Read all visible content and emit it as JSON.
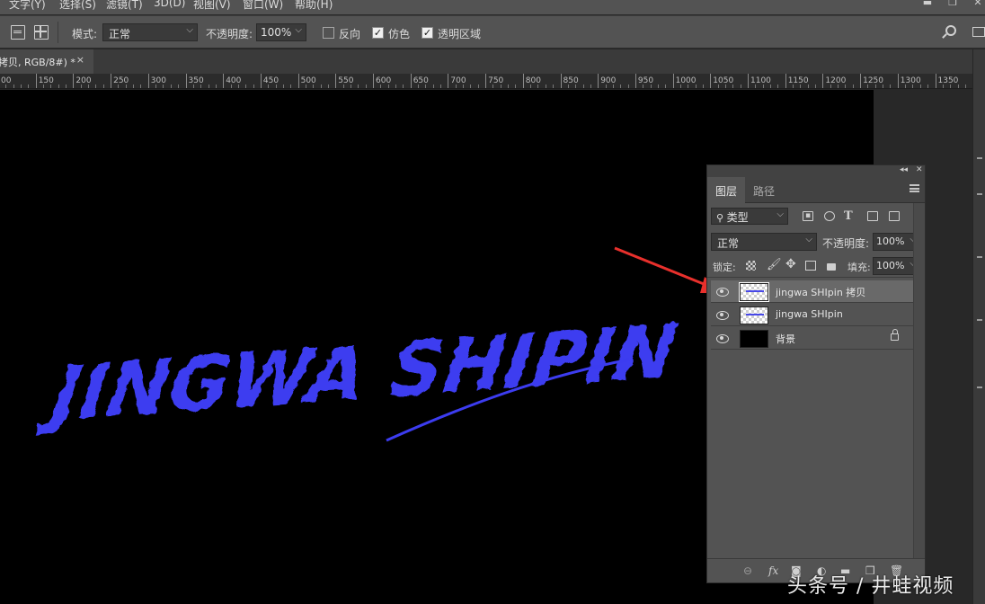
{
  "menubar": {
    "items": [
      "文字(Y)",
      "选择(S)",
      "滤镜(T)",
      "3D(D)",
      "视图(V)",
      "窗口(W)",
      "帮助(H)"
    ]
  },
  "options": {
    "mode_label": "模式:",
    "mode_value": "正常",
    "opacity_label": "不透明度:",
    "opacity_value": "100%",
    "reverse_label": "反向",
    "reverse_checked": false,
    "dither_label": "仿色",
    "dither_checked": true,
    "transparency_label": "透明区域",
    "transparency_checked": true
  },
  "document": {
    "tab_title": "拷贝, RGB/8#) *",
    "close_glyph": "×"
  },
  "ruler": {
    "labels": [
      "00",
      "150",
      "200",
      "250",
      "300",
      "350",
      "400",
      "450",
      "500",
      "550",
      "600",
      "650",
      "700",
      "750",
      "800",
      "850",
      "900",
      "950",
      "1000",
      "1050",
      "1100",
      "1150",
      "1200",
      "1250",
      "1300",
      "1350"
    ]
  },
  "canvas": {
    "artwork_text": "JINGWA SHIPIN",
    "artwork_color": "#3c3cf0",
    "arrow_color": "#e8302c"
  },
  "layers_panel": {
    "tabs": [
      "图层",
      "路径"
    ],
    "active_tab": 0,
    "filter_label": "类型",
    "blend_mode": "正常",
    "opacity_label": "不透明度:",
    "opacity_value": "100%",
    "lock_label": "锁定:",
    "fill_label": "填充:",
    "fill_value": "100%",
    "layers": [
      {
        "name": "jingwa SHIpin 拷贝",
        "selected": true,
        "thumb": "transparent-text",
        "locked": false
      },
      {
        "name": "jingwa SHIpin",
        "selected": false,
        "thumb": "transparent-text",
        "locked": false
      },
      {
        "name": "背景",
        "selected": false,
        "thumb": "black",
        "locked": true
      }
    ]
  },
  "watermark": "头条号 / 井蛙视频"
}
